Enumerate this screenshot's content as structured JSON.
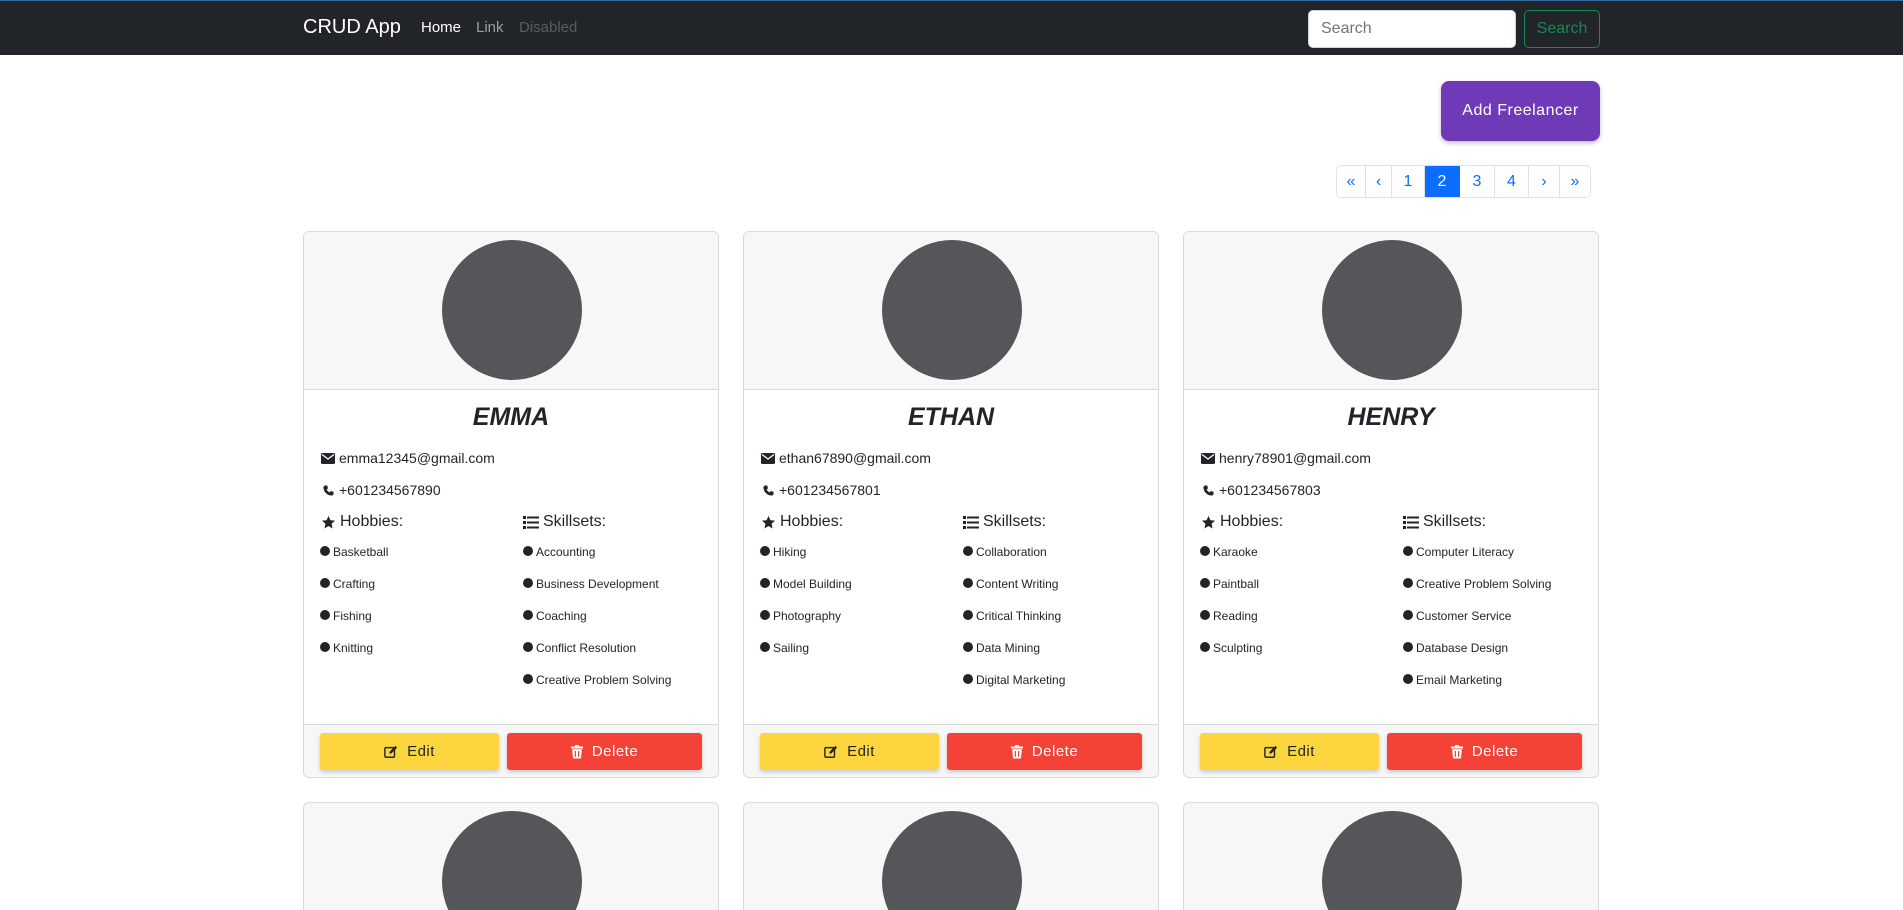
{
  "navbar": {
    "brand": "CRUD App",
    "links": {
      "home": "Home",
      "link": "Link",
      "disabled": "Disabled"
    },
    "search_placeholder": "Search",
    "search_button": "Search"
  },
  "add_button": "Add Freelancer",
  "pagination": {
    "first": "«",
    "prev": "‹",
    "pages": [
      "1",
      "2",
      "3",
      "4"
    ],
    "active_page": "2",
    "next": "›",
    "last": "»"
  },
  "labels": {
    "hobbies": "Hobbies:",
    "skillsets": "Skillsets:",
    "edit": "Edit",
    "delete": "Delete"
  },
  "freelancers": [
    {
      "name": "EMMA",
      "email": "emma12345@gmail.com",
      "phone": "+601234567890",
      "hobbies": [
        "Basketball",
        "Crafting",
        "Fishing",
        "Knitting"
      ],
      "skillsets": [
        "Accounting",
        "Business Development",
        "Coaching",
        "Conflict Resolution",
        "Creative Problem Solving"
      ]
    },
    {
      "name": "ETHAN",
      "email": "ethan67890@gmail.com",
      "phone": "+601234567801",
      "hobbies": [
        "Hiking",
        "Model Building",
        "Photography",
        "Sailing"
      ],
      "skillsets": [
        "Collaboration",
        "Content Writing",
        "Critical Thinking",
        "Data Mining",
        "Digital Marketing"
      ]
    },
    {
      "name": "HENRY",
      "email": "henry78901@gmail.com",
      "phone": "+601234567803",
      "hobbies": [
        "Karaoke",
        "Paintball",
        "Reading",
        "Sculpting"
      ],
      "skillsets": [
        "Computer Literacy",
        "Creative Problem Solving",
        "Customer Service",
        "Database Design",
        "Email Marketing"
      ]
    }
  ],
  "colors": {
    "navbar": "#212529",
    "accent_purple": "#6f3ab8",
    "edit_yellow": "#fdd63f",
    "delete_red": "#f44336",
    "pagination_blue": "#0d6efd",
    "search_green": "#198754"
  }
}
